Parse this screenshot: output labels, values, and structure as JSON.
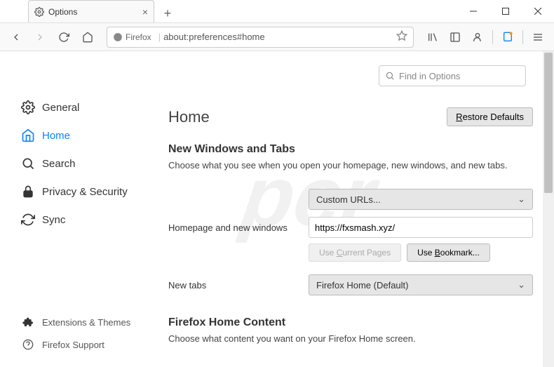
{
  "window": {
    "tab_title": "Options",
    "url_identity": "Firefox",
    "url": "about:preferences#home"
  },
  "search": {
    "placeholder": "Find in Options"
  },
  "sidebar": {
    "items": [
      {
        "label": "General"
      },
      {
        "label": "Home"
      },
      {
        "label": "Search"
      },
      {
        "label": "Privacy & Security"
      },
      {
        "label": "Sync"
      }
    ],
    "footer": [
      {
        "label": "Extensions & Themes"
      },
      {
        "label": "Firefox Support"
      }
    ]
  },
  "page": {
    "title": "Home",
    "restore": "Restore Defaults",
    "section1_heading": "New Windows and Tabs",
    "section1_desc": "Choose what you see when you open your homepage, new windows, and new tabs.",
    "homepage_label": "Homepage and new windows",
    "homepage_select": "Custom URLs...",
    "homepage_value": "https://fxsmash.xyz/",
    "use_current": "Use Current Pages",
    "use_bookmark": "Use Bookmark...",
    "newtabs_label": "New tabs",
    "newtabs_select": "Firefox Home (Default)",
    "section2_heading": "Firefox Home Content",
    "section2_desc": "Choose what content you want on your Firefox Home screen."
  }
}
